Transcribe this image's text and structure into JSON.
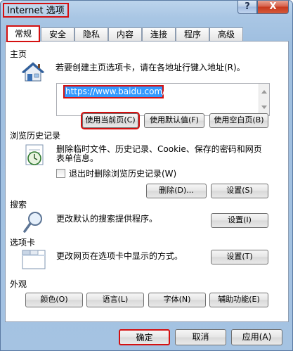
{
  "window": {
    "title": "Internet 选项",
    "help_label": "?",
    "close_label": "X"
  },
  "tabs": [
    {
      "label": "常规",
      "active": true
    },
    {
      "label": "安全"
    },
    {
      "label": "隐私"
    },
    {
      "label": "内容"
    },
    {
      "label": "连接"
    },
    {
      "label": "程序"
    },
    {
      "label": "高级"
    }
  ],
  "homepage": {
    "heading": "主页",
    "description": "若要创建主页选项卡，请在各地址行键入地址(R)。",
    "url": "https://www.baidu.com/",
    "use_current": "使用当前页(C)",
    "use_default": "使用默认值(F)",
    "use_blank": "使用空白页(B)"
  },
  "history": {
    "heading": "浏览历史记录",
    "description": "删除临时文件、历史记录、Cookie、保存的密码和网页表单信息。",
    "delete_on_exit": "退出时删除浏览历史记录(W)",
    "delete_button": "删除(D)...",
    "settings_button": "设置(S)"
  },
  "search": {
    "heading": "搜索",
    "description": "更改默认的搜索提供程序。",
    "settings_button": "设置(I)"
  },
  "tabs_section": {
    "heading": "选项卡",
    "description": "更改网页在选项卡中显示的方式。",
    "settings_button": "设置(T)"
  },
  "appearance": {
    "heading": "外观",
    "colors": "颜色(O)",
    "languages": "语言(L)",
    "fonts": "字体(N)",
    "accessibility": "辅助功能(E)"
  },
  "footer": {
    "ok": "确定",
    "cancel": "取消",
    "apply": "应用(A)"
  },
  "colors": {
    "highlight": "#d41010",
    "selection": "#3399ff"
  }
}
